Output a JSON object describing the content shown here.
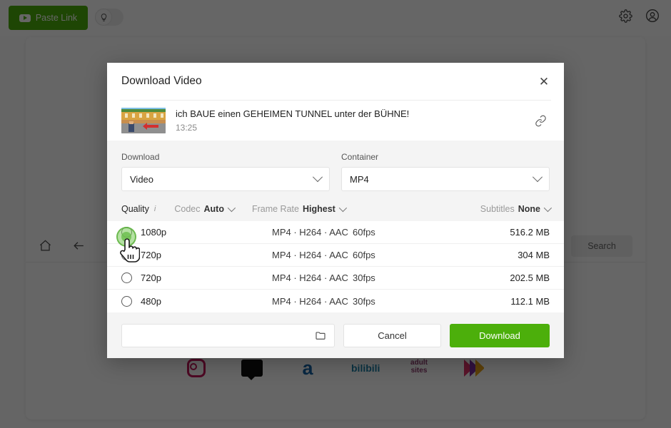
{
  "topbar": {
    "paste_link_label": "Paste Link",
    "paste_icon": "youtube-play-icon",
    "bulb_icon": "lightbulb-icon",
    "settings_icon": "gear-icon",
    "account_icon": "user-account-icon"
  },
  "background": {
    "nav": {
      "home_icon": "home-icon",
      "back_icon": "arrow-left-icon",
      "forward_icon": "arrow-right-icon"
    },
    "search_button_label": "Search",
    "sites": [
      {
        "name": "instagram-logo",
        "label": ""
      },
      {
        "name": "tiktok-logo",
        "label": ""
      },
      {
        "name": "letter-a-logo",
        "label": "a"
      },
      {
        "name": "bilibili-logo",
        "label": "bilibili"
      },
      {
        "name": "adult-sites-logo",
        "label_line1": "adult",
        "label_line2": "sites"
      },
      {
        "name": "chevron-stripes-logo",
        "label": ""
      }
    ]
  },
  "modal": {
    "title": "Download Video",
    "close_icon": "close-icon",
    "video": {
      "title": "ich BAUE einen GEHEIMEN TUNNEL unter der BÜHNE!",
      "duration": "13:25",
      "link_icon": "link-icon",
      "thumbnail": "minecraft-village-thumbnail"
    },
    "download_field": {
      "label": "Download",
      "value": "Video",
      "caret_icon": "chevron-down-icon"
    },
    "container_field": {
      "label": "Container",
      "value": "MP4",
      "caret_icon": "chevron-down-icon"
    },
    "filters": {
      "quality_label": "Quality",
      "info_icon": "info-icon",
      "codec_label": "Codec",
      "codec_value": "Auto",
      "frame_rate_label": "Frame Rate",
      "frame_rate_value": "Highest",
      "subtitles_label": "Subtitles",
      "subtitles_value": "None"
    },
    "quality_rows": [
      {
        "resolution": "1080p",
        "codec": "MP4 · H264 · AAC",
        "fps": "60fps",
        "size": "516.2 MB",
        "selected": false
      },
      {
        "resolution": "720p",
        "codec": "MP4 · H264 · AAC",
        "fps": "60fps",
        "size": "304 MB",
        "selected": false
      },
      {
        "resolution": "720p",
        "codec": "MP4 · H264 · AAC",
        "fps": "30fps",
        "size": "202.5 MB",
        "selected": false
      },
      {
        "resolution": "480p",
        "codec": "MP4 · H264 · AAC",
        "fps": "30fps",
        "size": "112.1 MB",
        "selected": false
      }
    ],
    "footer": {
      "path_value": "",
      "path_placeholder": "",
      "folder_icon": "folder-icon",
      "cancel_label": "Cancel",
      "download_label": "Download"
    }
  },
  "cursor": {
    "icon": "hand-pointer-cursor",
    "click_indicator": "green-click-ripple"
  },
  "colors": {
    "accent_green": "#4caf0b",
    "overlay": "rgba(0,0,0,0.60)",
    "modal_body_gray": "#f4f4f4"
  }
}
